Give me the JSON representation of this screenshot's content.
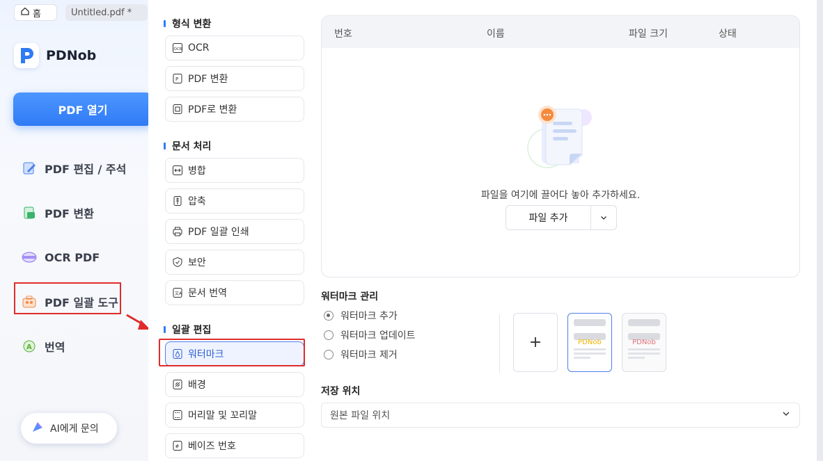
{
  "tabs": {
    "home": "홈",
    "file": "Untitled.pdf *"
  },
  "app": {
    "name": "PDNob"
  },
  "open_pdf": "PDF 열기",
  "nav": [
    {
      "label": "PDF 편집 / 주석",
      "icon": "edit-icon"
    },
    {
      "label": "PDF 변환",
      "icon": "convert-icon"
    },
    {
      "label": "OCR PDF",
      "icon": "ocr-icon"
    },
    {
      "label": "PDF 일괄 도구",
      "icon": "batch-tools-icon"
    },
    {
      "label": "번역",
      "icon": "translate-icon"
    }
  ],
  "ai_button": "AI에게 문의",
  "sections": {
    "format": "형식 변환",
    "document": "문서 처리",
    "batch": "일괄 편집"
  },
  "tools": {
    "ocr": "OCR",
    "pdf_convert": "PDF 변환",
    "to_pdf": "PDF로 변환",
    "merge": "병합",
    "compress": "압축",
    "batch_print": "PDF 일괄 인쇄",
    "security": "보안",
    "translate_doc": "문서 번역",
    "watermark": "워터마크",
    "background": "배경",
    "header_footer": "머리말 및 꼬리말",
    "bates": "베이즈 번호"
  },
  "table": {
    "columns": [
      "번호",
      "이름",
      "파일 크기",
      "상태"
    ],
    "empty_text": "파일을 여기에 끌어다 놓아 추가하세요.",
    "add_file": "파일 추가"
  },
  "watermark": {
    "title": "워터마크 관리",
    "options": [
      "워터마크 추가",
      "워터마크 업데이트",
      "워터마크 제거"
    ],
    "selected": 0,
    "preview_text": "PDNob",
    "preview_colors": [
      "#f0b400",
      "#e0707a"
    ]
  },
  "save": {
    "title": "저장 위치",
    "value": "원본 파일 위치"
  },
  "colors": {
    "accent": "#2f7bf5",
    "highlight": "#e02b2b"
  }
}
